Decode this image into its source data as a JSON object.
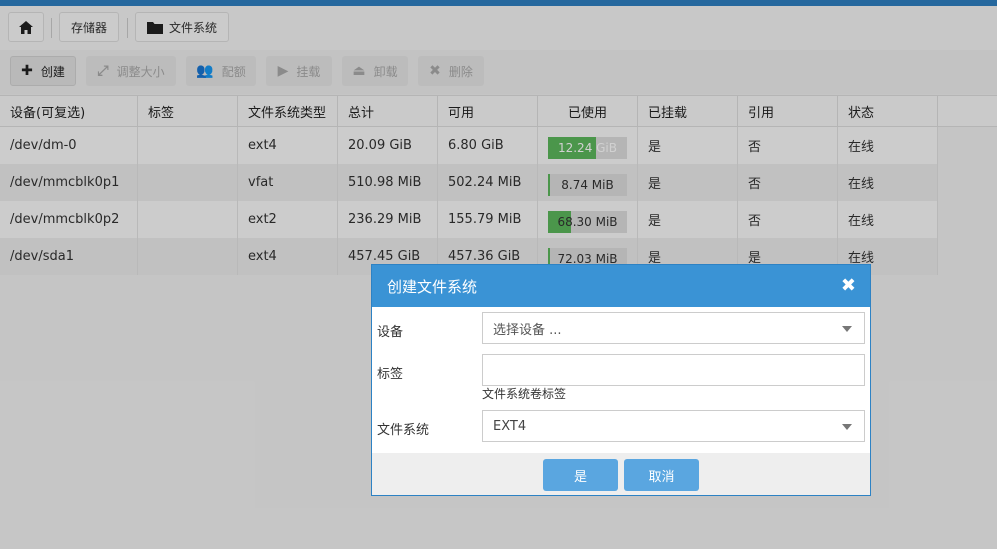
{
  "breadcrumb": {
    "storage": "存储器",
    "filesystems": "文件系统"
  },
  "toolbar": {
    "create": "创建",
    "resize": "调整大小",
    "quota": "配额",
    "mount": "挂载",
    "unmount": "卸载",
    "delete": "删除"
  },
  "table": {
    "headers": [
      "设备(可复选)",
      "标签",
      "文件系统类型",
      "总计",
      "可用",
      "已使用",
      "已挂载",
      "引用",
      "状态"
    ],
    "rows": [
      {
        "device": "/dev/dm-0",
        "label": "",
        "fstype": "ext4",
        "total": "20.09 GiB",
        "available": "6.80 GiB",
        "used": "12.24 GiB",
        "used_fraction": 0.61,
        "mounted": "是",
        "referenced": "否",
        "status": "在线"
      },
      {
        "device": "/dev/mmcblk0p1",
        "label": "",
        "fstype": "vfat",
        "total": "510.98 MiB",
        "available": "502.24 MiB",
        "used": "8.74 MiB",
        "used_fraction": 0.02,
        "mounted": "是",
        "referenced": "否",
        "status": "在线"
      },
      {
        "device": "/dev/mmcblk0p2",
        "label": "",
        "fstype": "ext2",
        "total": "236.29 MiB",
        "available": "155.79 MiB",
        "used": "68.30 MiB",
        "used_fraction": 0.29,
        "mounted": "是",
        "referenced": "否",
        "status": "在线"
      },
      {
        "device": "/dev/sda1",
        "label": "",
        "fstype": "ext4",
        "total": "457.45 GiB",
        "available": "457.36 GiB",
        "used": "72.03 MiB",
        "used_fraction": 0.002,
        "mounted": "是",
        "referenced": "是",
        "status": "在线"
      }
    ]
  },
  "dialog": {
    "title": "创建文件系统",
    "device_label": "设备",
    "device_placeholder": "选择设备 ...",
    "label_label": "标签",
    "label_value": "",
    "label_hint": "文件系统卷标签",
    "fs_label": "文件系统",
    "fs_value": "EXT4",
    "yes": "是",
    "cancel": "取消"
  },
  "colors": {
    "accent": "#3a93d5",
    "usage_bar": "#5cb85c",
    "button": "#5aa6e0"
  }
}
